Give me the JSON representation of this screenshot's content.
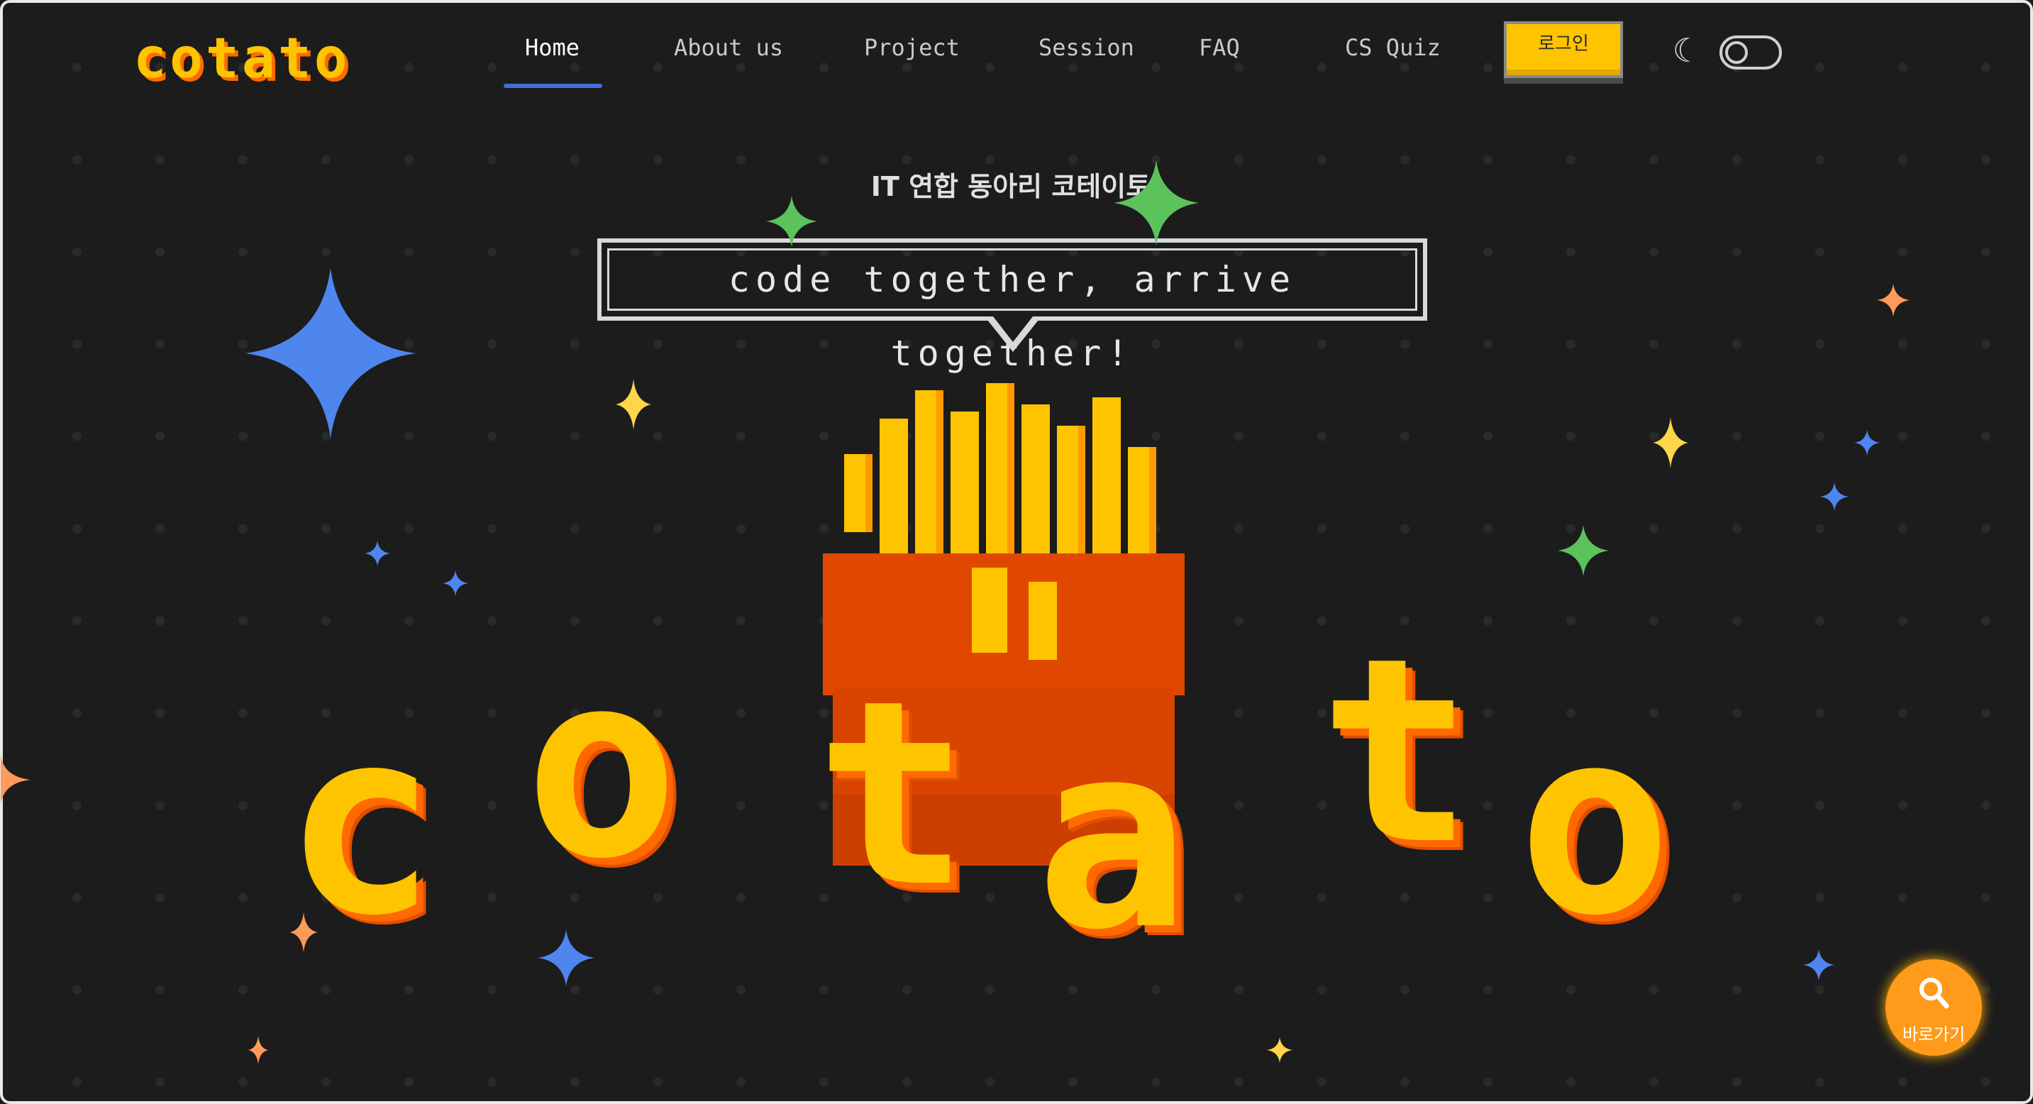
{
  "brand": {
    "logo": "cotato"
  },
  "nav": {
    "items": [
      {
        "label": "Home",
        "active": true
      },
      {
        "label": "About us"
      },
      {
        "label": "Project"
      },
      {
        "label": "Session"
      },
      {
        "label": "FAQ"
      },
      {
        "label": "CS Quiz"
      }
    ],
    "login_label": "로그인",
    "theme_icon": "moon-icon"
  },
  "hero": {
    "subtitle": "IT 연합 동아리 코테이토",
    "tagline": "code together, arrive together!",
    "word": "cotato",
    "mascot_icon": "french-fries-icon"
  },
  "fab": {
    "label": "바로가기",
    "icon": "search-icon"
  },
  "colors": {
    "background": "#1c1c1c",
    "brand_yellow": "#ffc400",
    "brand_orange": "#ff6a00",
    "accent_blue": "#3f6fd9",
    "fab_orange": "#ff9a1a"
  }
}
